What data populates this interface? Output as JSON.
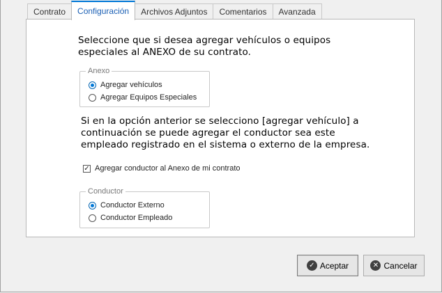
{
  "tabs": [
    {
      "label": "Contrato"
    },
    {
      "label": "Configuración",
      "active": true
    },
    {
      "label": "Archivos Adjuntos"
    },
    {
      "label": "Comentarios"
    },
    {
      "label": "Avanzada"
    }
  ],
  "intro": {
    "line1": "Seleccione que si desea agregar vehículos o equipos",
    "line2": "especiales al ANEXO de su contrato."
  },
  "anexo_group": {
    "legend": "Anexo",
    "options": [
      {
        "label": "Agregar vehículos",
        "selected": true
      },
      {
        "label": "Agregar Equipos Especiales",
        "selected": false
      }
    ]
  },
  "note": {
    "line1": "Si en la opción anterior se selecciono [agregar vehículo] a",
    "line2": "continuación se puede agregar el conductor sea este",
    "line3": "empleado registrado en el sistema o externo de la empresa."
  },
  "add_driver_checkbox": {
    "label": "Agregar conductor al Anexo de mi contrato",
    "checked": true
  },
  "conductor_group": {
    "legend": "Conductor",
    "options": [
      {
        "label": "Conductor Externo",
        "selected": true
      },
      {
        "label": "Conductor Empleado",
        "selected": false
      }
    ]
  },
  "buttons": {
    "accept": {
      "label": "Aceptar",
      "icon": "check-circle-icon"
    },
    "cancel": {
      "label": "Cancelar",
      "icon": "close-circle-icon"
    }
  }
}
